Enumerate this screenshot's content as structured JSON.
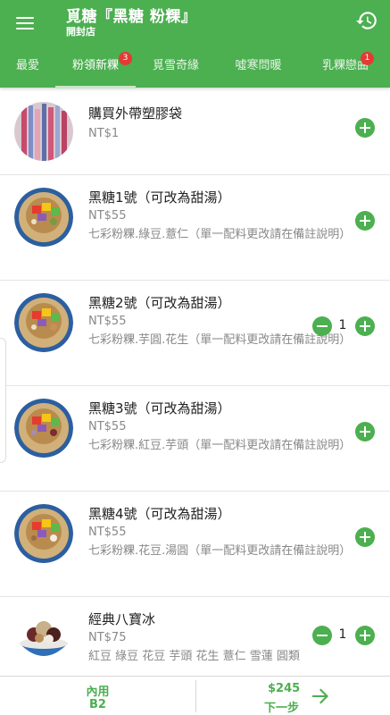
{
  "header": {
    "title": "覓糖『黑糖 粉粿』",
    "subtitle": "開封店",
    "menu_icon": "menu-icon",
    "history_icon": "history-icon",
    "color": "#4caf50"
  },
  "tabs": [
    {
      "label": "最愛",
      "badge": null,
      "active": false
    },
    {
      "label": "粉領新粿",
      "badge": "3",
      "active": true
    },
    {
      "label": "覓雪奇緣",
      "badge": null,
      "active": false
    },
    {
      "label": "噓寒問暖",
      "badge": null,
      "active": false
    },
    {
      "label": "乳粿戀曲",
      "badge": "1",
      "active": false
    }
  ],
  "items": [
    {
      "name": "購買外帶塑膠袋",
      "price": "NT$1",
      "desc": "",
      "qty": null
    },
    {
      "name": "黑糖1號（可改為甜湯）",
      "price": "NT$55",
      "desc": "七彩粉粿.綠豆.薏仁（單一配料更改請在備註說明）",
      "qty": null
    },
    {
      "name": "黑糖2號（可改為甜湯）",
      "price": "NT$55",
      "desc": "七彩粉粿.芋圓.花生（單一配料更改請在備註說明）",
      "qty": "1"
    },
    {
      "name": "黑糖3號（可改為甜湯）",
      "price": "NT$55",
      "desc": "七彩粉粿.紅豆.芋頭（單一配料更改請在備註說明）",
      "qty": null
    },
    {
      "name": "黑糖4號（可改為甜湯）",
      "price": "NT$55",
      "desc": "七彩粉粿.花豆.湯圓（單一配料更改請在備註說明）",
      "qty": null
    },
    {
      "name": "經典八寶冰",
      "price": "NT$75",
      "desc": "紅豆 綠豆 花豆 芋頭 花生 薏仁 雪蓮 圓類",
      "qty": "1"
    }
  ],
  "footer": {
    "dine_label": "內用",
    "table": "B2",
    "total": "$245",
    "next_label": "下一步",
    "arrow_icon": "arrow-right-icon"
  }
}
